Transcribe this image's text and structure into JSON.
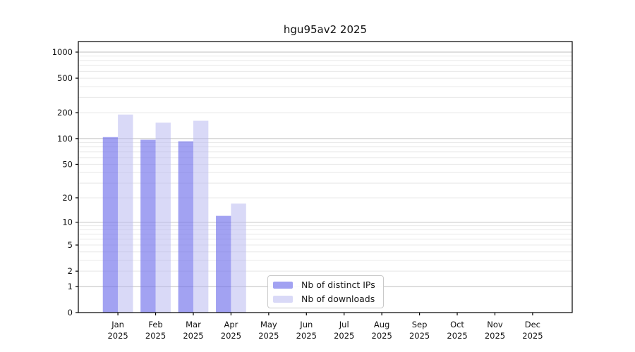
{
  "chart_data": {
    "type": "bar",
    "title": "hgu95av2 2025",
    "x_tick_year": "2025",
    "categories": [
      "Jan",
      "Feb",
      "Mar",
      "Apr",
      "May",
      "Jun",
      "Jul",
      "Aug",
      "Sep",
      "Oct",
      "Nov",
      "Dec"
    ],
    "series": [
      {
        "name": "Nb of distinct IPs",
        "color": "rgba(112,112,235,0.65)",
        "values": [
          104,
          97,
          93,
          12,
          0,
          0,
          0,
          0,
          0,
          0,
          0,
          0
        ]
      },
      {
        "name": "Nb of downloads",
        "color": "rgba(180,180,240,0.5)",
        "values": [
          190,
          153,
          161,
          17,
          0,
          0,
          0,
          0,
          0,
          0,
          0,
          0
        ]
      }
    ],
    "yscale": "log1p",
    "ylim": [
      0,
      1300
    ],
    "yticks": [
      0,
      1,
      2,
      5,
      10,
      20,
      50,
      100,
      200,
      500,
      1000
    ],
    "major_gridlines": [
      1,
      10,
      100,
      1000
    ],
    "grid": true,
    "legend_position": "lower center"
  },
  "colors": {
    "axis": "#000000",
    "text": "#111111",
    "grid_major": "#cccccc",
    "grid_minor": "#e8e8e8",
    "background": "#ffffff",
    "legend_border": "#c9c9c9"
  }
}
